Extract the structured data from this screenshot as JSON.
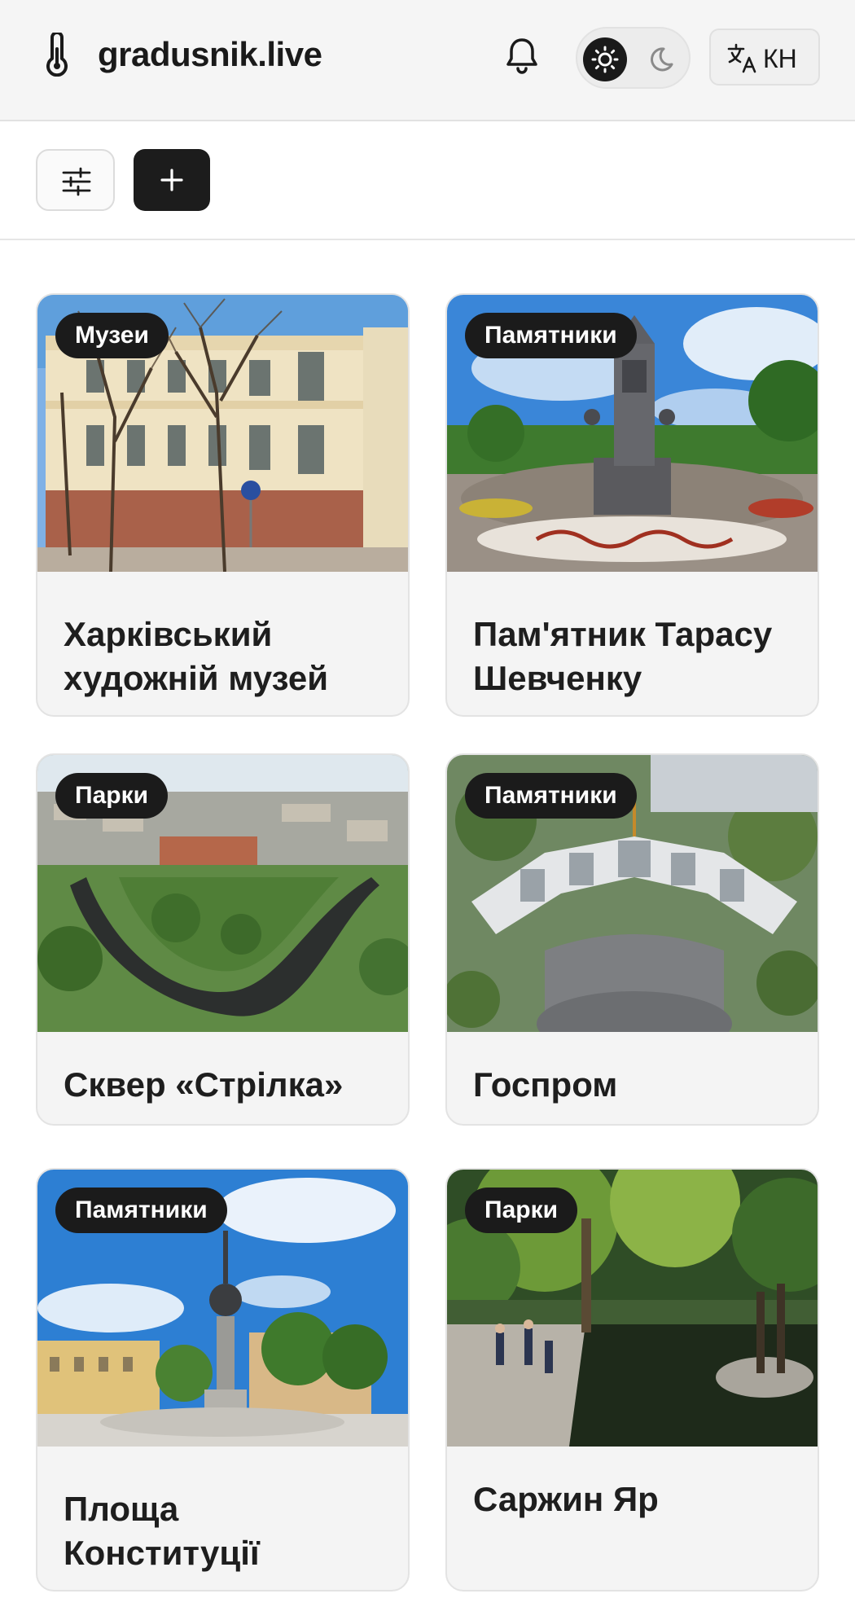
{
  "header": {
    "brand": "gradusnik.live",
    "language_code": "КН"
  },
  "cards": [
    {
      "category": "Музеи",
      "title": "Харківський художній музей"
    },
    {
      "category": "Памятники",
      "title": "Пам'ятник Тарасу Шевченку"
    },
    {
      "category": "Парки",
      "title": "Сквер «Стрілка»"
    },
    {
      "category": "Памятники",
      "title": "Госпром"
    },
    {
      "category": "Памятники",
      "title": "Площа Конституції"
    },
    {
      "category": "Парки",
      "title": "Саржин Яр"
    }
  ]
}
